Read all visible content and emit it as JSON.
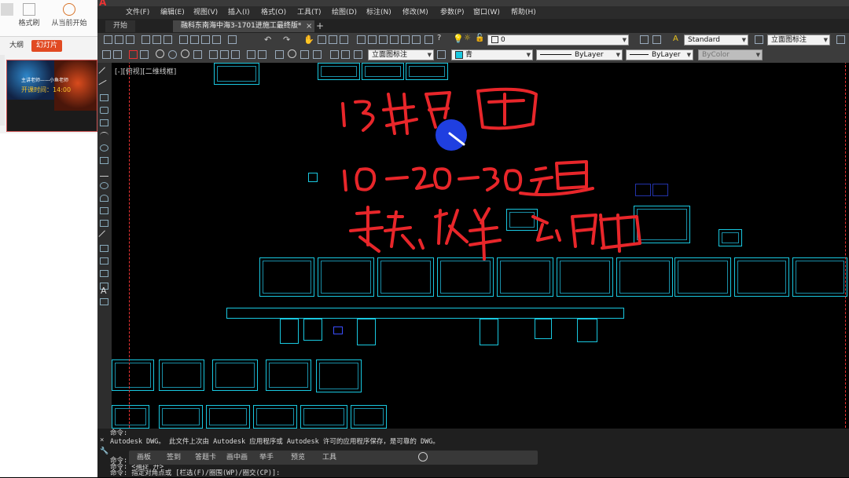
{
  "ppt": {
    "ribbon": {
      "btn1": "",
      "btn2": "格式刷",
      "btn3": "从当前开始"
    },
    "tabs": [
      "大纲",
      "幻灯片"
    ],
    "thumb": {
      "line1": "主讲老师——小鱼老师",
      "line2": "开课时间：14:00"
    }
  },
  "cad": {
    "menu": [
      "文件(F)",
      "编辑(E)",
      "视图(V)",
      "插入(I)",
      "格式(O)",
      "工具(T)",
      "绘图(D)",
      "标注(N)",
      "修改(M)",
      "参数(P)",
      "窗口(W)",
      "帮助(H)"
    ],
    "tabs": {
      "start": "开始",
      "document": "融科东南海中海3-1701进施工最终版*"
    },
    "toolbar1": {
      "layer_value": "0",
      "text_style": "Standard",
      "dim_style": "立面图标注"
    },
    "toolbar2": {
      "dim_style": "立面图标注",
      "color": "青",
      "linetype": "ByLayer",
      "lineweight": "ByLayer",
      "plotstyle": "ByColor"
    },
    "viewport_label": "[-][俯视][二维线框]",
    "handwriting": {
      "line1": "13张平面",
      "line2": "10-20-30立面",
      "line3": "节点，大样，吊顶"
    },
    "command": {
      "lines": [
        "命令:",
        "Autodesk DWG。  此文件上次由 Autodesk 应用程序或 Autodesk 许可的应用程序保存，是可靠的 DWG。",
        "命令:",
        "命令: <捕捉 开>",
        "命令: 指定对角点或 [栏选(F)/圈围(WP)/圈交(CP)]:"
      ],
      "bar_items": [
        "画板",
        "签到",
        "答题卡",
        "画中画",
        "举手",
        "预览",
        "工具"
      ]
    },
    "colors": {
      "sheet_border": "#19c8e0",
      "ink": "#e8262a",
      "cursor": "#1f3fe0"
    }
  }
}
